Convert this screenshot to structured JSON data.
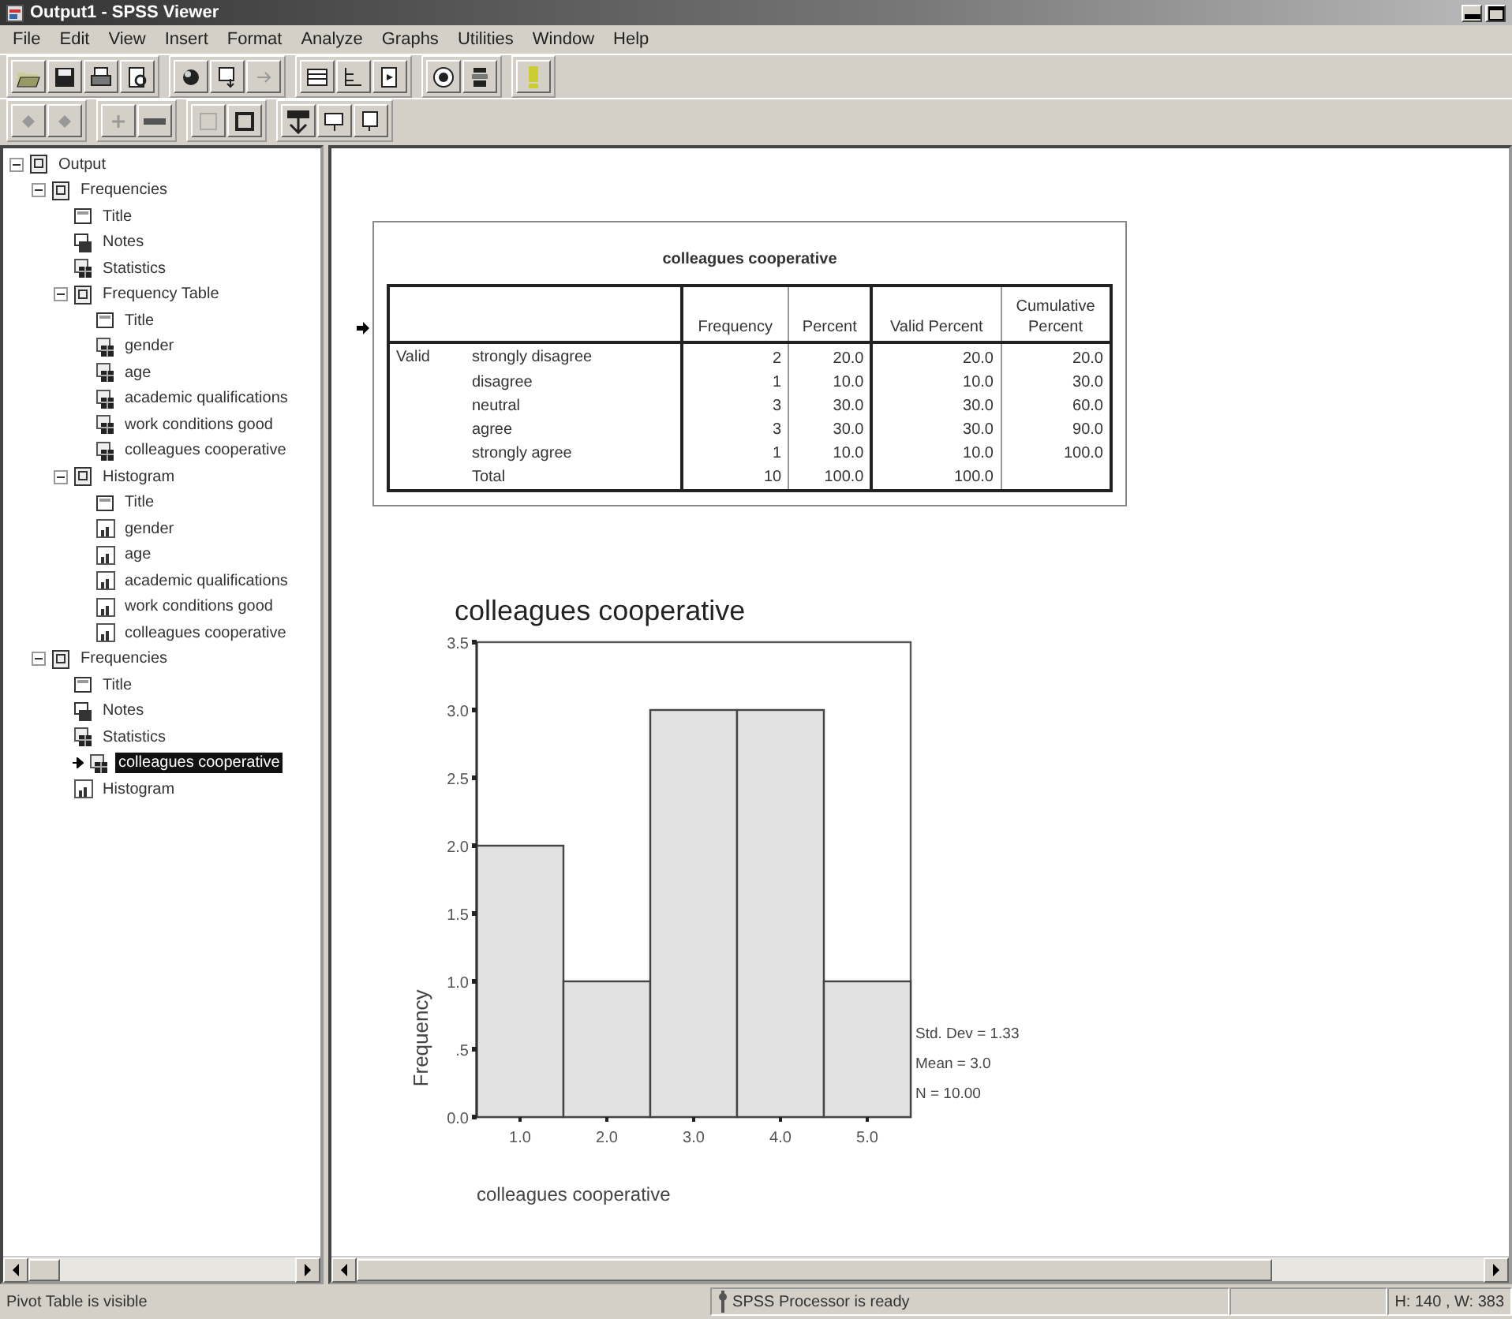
{
  "window": {
    "title": "Output1 - SPSS Viewer"
  },
  "menu": [
    "File",
    "Edit",
    "View",
    "Insert",
    "Format",
    "Analyze",
    "Graphs",
    "Utilities",
    "Window",
    "Help"
  ],
  "outline": [
    {
      "label": "Output",
      "kind": "book",
      "expanded": true,
      "selected": false,
      "children": [
        {
          "label": "Frequencies",
          "kind": "book",
          "expanded": true,
          "selected": false,
          "children": [
            {
              "label": "Title",
              "kind": "title",
              "selected": false
            },
            {
              "label": "Notes",
              "kind": "notes",
              "selected": false
            },
            {
              "label": "Statistics",
              "kind": "table",
              "selected": false
            },
            {
              "label": "Frequency Table",
              "kind": "book",
              "expanded": true,
              "selected": false,
              "children": [
                {
                  "label": "Title",
                  "kind": "title",
                  "selected": false
                },
                {
                  "label": "gender",
                  "kind": "table",
                  "selected": false
                },
                {
                  "label": "age",
                  "kind": "table",
                  "selected": false
                },
                {
                  "label": "academic qualifications",
                  "kind": "table",
                  "selected": false
                },
                {
                  "label": "work conditions good",
                  "kind": "table",
                  "selected": false
                },
                {
                  "label": "colleagues cooperative",
                  "kind": "table",
                  "selected": false
                }
              ]
            },
            {
              "label": "Histogram",
              "kind": "book",
              "expanded": true,
              "selected": false,
              "children": [
                {
                  "label": "Title",
                  "kind": "title",
                  "selected": false
                },
                {
                  "label": "gender",
                  "kind": "chart",
                  "selected": false
                },
                {
                  "label": "age",
                  "kind": "chart",
                  "selected": false
                },
                {
                  "label": "academic qualifications",
                  "kind": "chart",
                  "selected": false
                },
                {
                  "label": "work conditions good",
                  "kind": "chart",
                  "selected": false
                },
                {
                  "label": "colleagues cooperative",
                  "kind": "chart",
                  "selected": false
                }
              ]
            }
          ]
        },
        {
          "label": "Frequencies",
          "kind": "book",
          "expanded": true,
          "selected": false,
          "children": [
            {
              "label": "Title",
              "kind": "title",
              "selected": false
            },
            {
              "label": "Notes",
              "kind": "notes",
              "selected": false
            },
            {
              "label": "Statistics",
              "kind": "table",
              "selected": false
            },
            {
              "label": "colleagues cooperative",
              "kind": "table",
              "selected": true
            },
            {
              "label": "Histogram",
              "kind": "chart",
              "selected": false
            }
          ]
        }
      ]
    }
  ],
  "pivot_table": {
    "title": "colleagues cooperative",
    "columns": [
      "Frequency",
      "Percent",
      "Valid Percent",
      "Cumulative Percent"
    ],
    "group": "Valid",
    "rows": [
      {
        "label": "strongly disagree",
        "cells": [
          "2",
          "20.0",
          "20.0",
          "20.0"
        ]
      },
      {
        "label": "disagree",
        "cells": [
          "1",
          "10.0",
          "10.0",
          "30.0"
        ]
      },
      {
        "label": "neutral",
        "cells": [
          "3",
          "30.0",
          "30.0",
          "60.0"
        ]
      },
      {
        "label": "agree",
        "cells": [
          "3",
          "30.0",
          "30.0",
          "90.0"
        ]
      },
      {
        "label": "strongly agree",
        "cells": [
          "1",
          "10.0",
          "10.0",
          "100.0"
        ]
      },
      {
        "label": "Total",
        "cells": [
          "10",
          "100.0",
          "100.0",
          ""
        ]
      }
    ]
  },
  "histogram": {
    "stats": [
      "Std. Dev = 1.33",
      "Mean = 3.0",
      "N = 10.00"
    ],
    "chart_data": {
      "type": "bar",
      "title": "colleagues cooperative",
      "xlabel": "colleagues cooperative",
      "ylabel": "Frequency",
      "categories": [
        "1.0",
        "2.0",
        "3.0",
        "4.0",
        "5.0"
      ],
      "values": [
        2,
        1,
        3,
        3,
        1
      ],
      "ylim": [
        0,
        3.5
      ],
      "yticks": [
        {
          "value": 0,
          "label": "0.0"
        },
        {
          "value": 0.5,
          "label": ".5"
        },
        {
          "value": 1,
          "label": "1.0"
        },
        {
          "value": 1.5,
          "label": "1.5"
        },
        {
          "value": 2,
          "label": "2.0"
        },
        {
          "value": 2.5,
          "label": "2.5"
        },
        {
          "value": 3,
          "label": "3.0"
        },
        {
          "value": 3.5,
          "label": "3.5"
        }
      ]
    }
  },
  "status_bar": {
    "message": "Pivot Table is visible",
    "processor": "SPSS Processor  is ready",
    "size": "H: 140 , W: 383"
  }
}
